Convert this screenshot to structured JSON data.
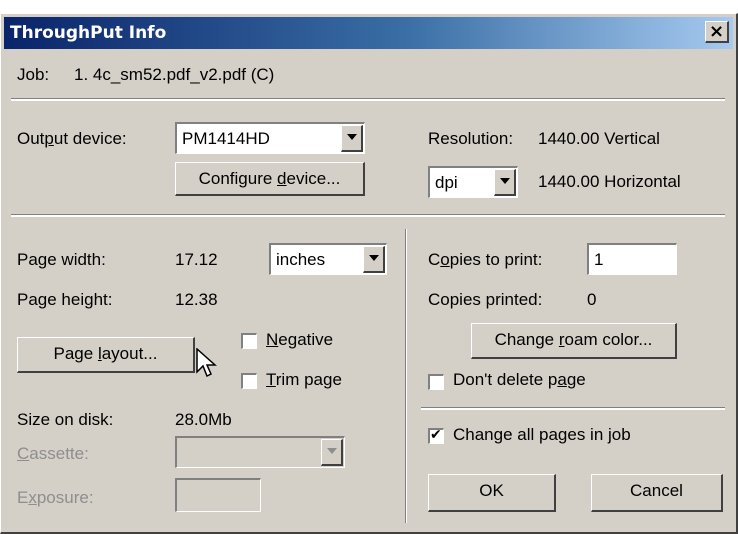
{
  "window": {
    "title": "ThroughPut Info",
    "close_glyph": "×"
  },
  "job": {
    "label": "Job:",
    "value": "1. 4c_sm52.pdf_v2.pdf (C)"
  },
  "output": {
    "device_label_pre": "Out",
    "device_label_ul": "p",
    "device_label_post": "ut device:",
    "device_value": "PM1414HD",
    "configure_pre": "Configure ",
    "configure_ul": "d",
    "configure_post": "evice..."
  },
  "resolution": {
    "label": "Resolution:",
    "vertical": "1440.00 Vertical",
    "horizontal": "1440.00 Horizontal",
    "unit": "dpi"
  },
  "page": {
    "width_label": "Page width:",
    "width_value": "17.12",
    "unit": "inches",
    "height_label": "Page height:",
    "height_value": "12.38",
    "layout_pre": "Page ",
    "layout_ul": "l",
    "layout_post": "ayout...",
    "negative_ul": "N",
    "negative_post": "egative",
    "negative_checked": false,
    "trim_ul": "T",
    "trim_post": "rim page",
    "trim_checked": false,
    "size_label": "Size on disk:",
    "size_value": "28.0Mb",
    "cassette_ul": "C",
    "cassette_post": "assette:",
    "exposure_pre": "E",
    "exposure_ul": "x",
    "exposure_post": "posure:"
  },
  "copies": {
    "to_print_pre": "C",
    "to_print_ul": "o",
    "to_print_post": "pies to print:",
    "to_print_value": "1",
    "printed_label": "Copies printed:",
    "printed_value": "0",
    "roam_pre": "Change ",
    "roam_ul": "r",
    "roam_post": "oam color...",
    "dont_delete_pre": "Don't delete p",
    "dont_delete_ul": "a",
    "dont_delete_post": "ge",
    "dont_delete_checked": false,
    "change_all_label": "Change all pages in job",
    "change_all_checked": true
  },
  "actions": {
    "ok": "OK",
    "cancel": "Cancel"
  },
  "icons": {
    "cursor": "mouse-pointer-icon",
    "check": "checkmark-icon"
  }
}
